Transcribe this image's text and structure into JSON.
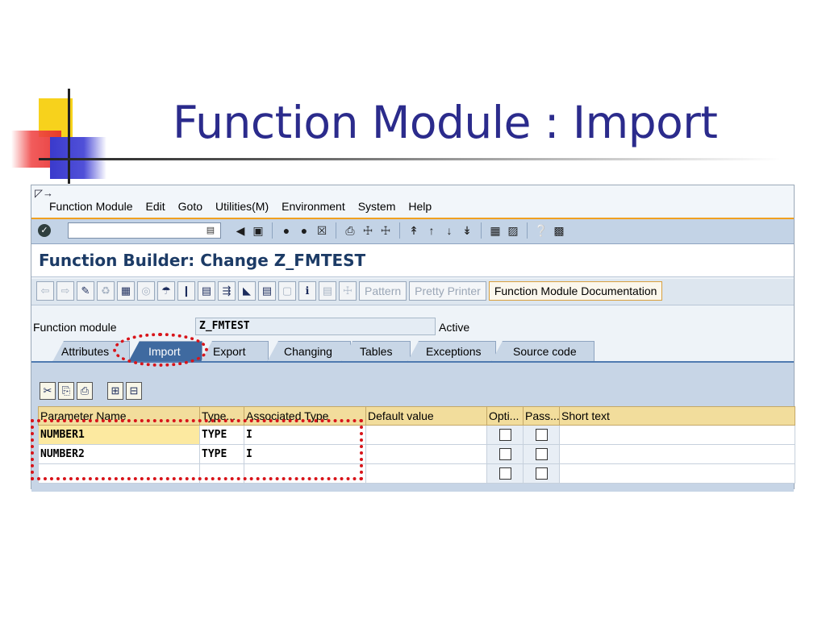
{
  "slide": {
    "title": "Function Module : Import"
  },
  "menu": {
    "items": [
      "Function Module",
      "Edit",
      "Goto",
      "Utilities(M)",
      "Environment",
      "System",
      "Help"
    ]
  },
  "screen": {
    "title": "Function Builder: Change Z_FMTEST"
  },
  "app_toolbar": {
    "pattern": "Pattern",
    "pretty_printer": "Pretty Printer",
    "documentation": "Function Module Documentation"
  },
  "header": {
    "label": "Function module",
    "value": "Z_FMTEST",
    "status": "Active"
  },
  "tabs": [
    "Attributes",
    "Import",
    "Export",
    "Changing",
    "Tables",
    "Exceptions",
    "Source code"
  ],
  "active_tab": "Import",
  "grid": {
    "columns": [
      "Parameter Name",
      "Type...",
      "Associated Type",
      "Default value",
      "Opti...",
      "Pass...",
      "Short text"
    ],
    "rows": [
      {
        "name": "NUMBER1",
        "type": "TYPE",
        "assoc": "I"
      },
      {
        "name": "NUMBER2",
        "type": "TYPE",
        "assoc": "I"
      },
      {
        "name": "",
        "type": "",
        "assoc": ""
      }
    ]
  },
  "icons": {
    "system": "menu-expand-icon",
    "enter": "check-icon",
    "annotation_color": "#d8141a"
  }
}
